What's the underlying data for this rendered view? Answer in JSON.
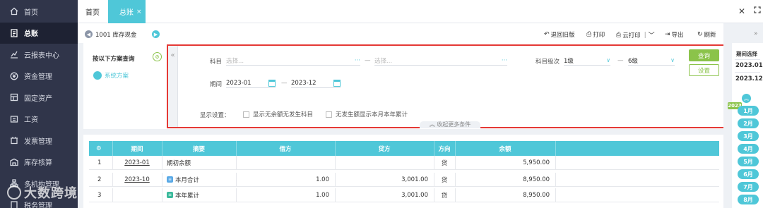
{
  "sidebar": {
    "items": [
      {
        "label": "首页",
        "icon": "home-icon"
      },
      {
        "label": "总账",
        "icon": "ledger-icon"
      },
      {
        "label": "云报表中心",
        "icon": "chart-icon"
      },
      {
        "label": "资金管理",
        "icon": "money-icon"
      },
      {
        "label": "固定资产",
        "icon": "asset-icon"
      },
      {
        "label": "工资",
        "icon": "salary-icon"
      },
      {
        "label": "发票管理",
        "icon": "invoice-icon"
      },
      {
        "label": "库存核算",
        "icon": "warehouse-icon"
      },
      {
        "label": "多机构管理",
        "icon": "org-icon"
      },
      {
        "label": "税务管理",
        "icon": "tax-icon"
      }
    ],
    "active_index": 1,
    "watermark": "大数跨境"
  },
  "tabs": {
    "home": "首页",
    "ledger": "总账",
    "close": "×"
  },
  "toolbar": {
    "account": "1001 库存现金",
    "back_old": "退回旧版",
    "print": "打印",
    "cloud_print": "云打印",
    "export": "导出",
    "refresh": "刷新"
  },
  "query": {
    "title": "按以下方案查询",
    "scheme": "系统方案",
    "subject_label": "科目",
    "subject_placeholder_from": "选择...",
    "subject_placeholder_to": "选择...",
    "level_label": "科目级次",
    "level_from": "1级",
    "level_to": "6级",
    "period_label": "期间",
    "period_from": "2023-01",
    "period_to": "2023-12",
    "dash": "—",
    "display_label": "显示设置：",
    "opt1": "显示无余额无发生科目",
    "opt2": "无发生额显示本月本年累计",
    "more": "收起更多条件",
    "query_btn": "查询",
    "setting_btn": "设置"
  },
  "period_panel": {
    "title": "期间选择",
    "from": "2023.01",
    "to": "2023.12",
    "year": "2023",
    "months": [
      "1月",
      "2月",
      "3月",
      "4月",
      "5月",
      "6月",
      "7月",
      "8月"
    ]
  },
  "table": {
    "headers": [
      "期间",
      "摘要",
      "借方",
      "贷方",
      "方向",
      "余额"
    ],
    "rows": [
      {
        "no": "1",
        "period": "2023-01",
        "summary": "期初余额",
        "tag": "",
        "debit": "",
        "credit": "",
        "dir": "贷",
        "balance": "5,950.00"
      },
      {
        "no": "2",
        "period": "2023-10",
        "summary": "本月合计",
        "tag": "blue",
        "debit": "1.00",
        "credit": "3,001.00",
        "dir": "贷",
        "balance": "8,950.00"
      },
      {
        "no": "3",
        "period": "",
        "summary": "本年累计",
        "tag": "green",
        "debit": "1.00",
        "credit": "3,001.00",
        "dir": "贷",
        "balance": "8,950.00"
      }
    ]
  },
  "colors": {
    "accent": "#4fc7d8",
    "green": "#8bc34a",
    "highlight_border": "#e53935",
    "sidebar_bg": "#30354a"
  }
}
